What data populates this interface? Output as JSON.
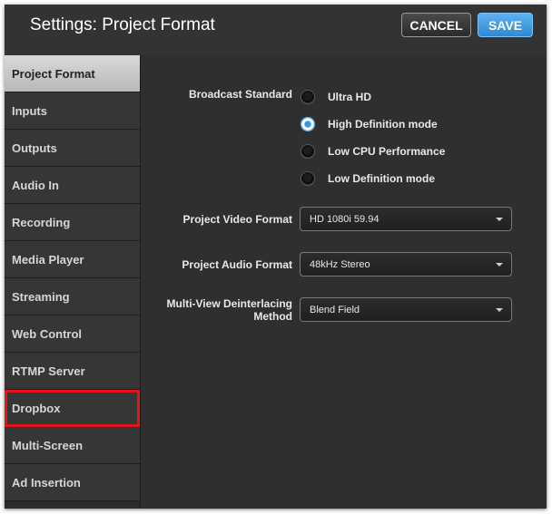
{
  "header": {
    "title": "Settings: Project Format",
    "cancel_label": "CANCEL",
    "save_label": "SAVE"
  },
  "sidebar": {
    "items": [
      {
        "label": "Project Format"
      },
      {
        "label": "Inputs"
      },
      {
        "label": "Outputs"
      },
      {
        "label": "Audio In"
      },
      {
        "label": "Recording"
      },
      {
        "label": "Media Player"
      },
      {
        "label": "Streaming"
      },
      {
        "label": "Web Control"
      },
      {
        "label": "RTMP Server"
      },
      {
        "label": "Dropbox"
      },
      {
        "label": "Multi-Screen"
      },
      {
        "label": "Ad Insertion"
      }
    ],
    "selected": "Project Format"
  },
  "main": {
    "broadcast_standard": {
      "label": "Broadcast Standard",
      "options": [
        {
          "label": "Ultra HD",
          "checked": false
        },
        {
          "label": "High Definition mode",
          "checked": true
        },
        {
          "label": "Low CPU Performance",
          "checked": false
        },
        {
          "label": "Low Definition mode",
          "checked": false
        }
      ]
    },
    "video_format": {
      "label": "Project Video Format",
      "value": "HD 1080i 59.94"
    },
    "audio_format": {
      "label": "Project Audio Format",
      "value": "48kHz Stereo"
    },
    "deinterlacing": {
      "label_line1": "Multi-View Deinterlacing",
      "label_line2": "Method",
      "value": "Blend Field"
    }
  },
  "colors": {
    "accent": "#3a94e4",
    "highlight_box": "#e0141c",
    "panel_bg": "#2f2f2f"
  },
  "icons": [
    "chevron-down-icon",
    "radio-button-icon"
  ]
}
